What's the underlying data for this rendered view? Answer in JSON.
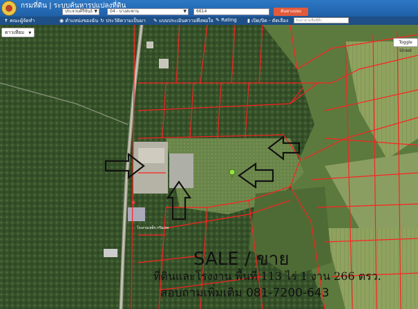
{
  "header": {
    "title": "กรมที่ดิน | ระบบค้นหารูปแปลงที่ดิน",
    "province": "ประจวบคีรีขันธ์",
    "district": "04 - บางสะพาน",
    "parcel_number": "6614",
    "search_button": "ค้นหาแปลง"
  },
  "toolbar": {
    "items": [
      "คณะผู้จัดทำ",
      "ตำแหน่งของฉัน",
      "ประวัติความเป็นมา",
      "แบบประเมินความพึงพอใจ",
      "Rating",
      "เปิด/ปิด - ตัดเลือง"
    ],
    "search_placeholder": "ค้นหาตามชื่อที่ตั้ง"
  },
  "map": {
    "basemap_select": "ดาวเทียม",
    "toggle_street": "Toggle Street",
    "place_label": "โรงงานเหล็ก กรีนเทค"
  },
  "overlay": {
    "headline": "SALE / ขาย",
    "detail": "ที่ดินและโรงงาน พื้นที่ 113 ไร่ 1 งาน 266 ตรว.",
    "contact": "สอบถามเพิ่มเติม 081-7200-643"
  },
  "colors": {
    "header_bg": "#1f5fa6",
    "toolbar_bg": "#1e4f86",
    "search_button": "#e35a3a",
    "parcel_lines": "#ff2020"
  }
}
